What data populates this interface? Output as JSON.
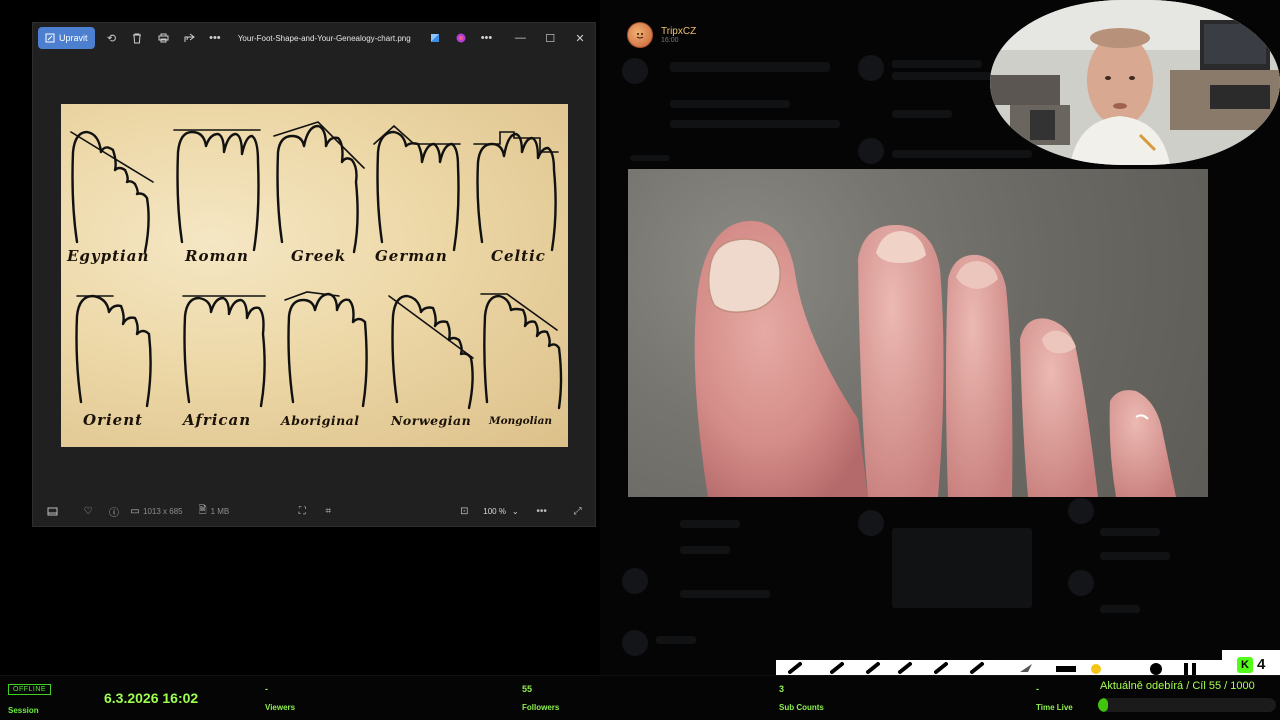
{
  "viewer": {
    "edit_label": "Upravit",
    "filename": "Your-Foot-Shape-and-Your-Genealogy-chart.png",
    "dimensions": "1013 x 685",
    "size": "1 MB",
    "zoom": "100 %"
  },
  "chart": {
    "labels": [
      "Egyptian",
      "Roman",
      "Greek",
      "German",
      "Celtic",
      "Orient",
      "African",
      "Aboriginal",
      "Norwegian",
      "Mongolian"
    ]
  },
  "chat": {
    "user": "TripxCZ",
    "time": "16:00"
  },
  "stream": {
    "status": "OFFLINE",
    "session_label": "Session",
    "datetime": "6.3.2026 16:02",
    "viewers_value": "-",
    "viewers_label": "Viewers",
    "followers_value": "55",
    "followers_label": "Followers",
    "subs_value": "3",
    "subs_label": "Sub Counts",
    "timelive_value": "-",
    "timelive_label": "Time Live",
    "goal_text": "Aktuálně odebírá / Cíl   55 / 1000",
    "goal_progress": 0.055,
    "kick_count": "4"
  },
  "colors": {
    "accent_green": "#53fc18",
    "edit_blue": "#4c7fcf"
  }
}
